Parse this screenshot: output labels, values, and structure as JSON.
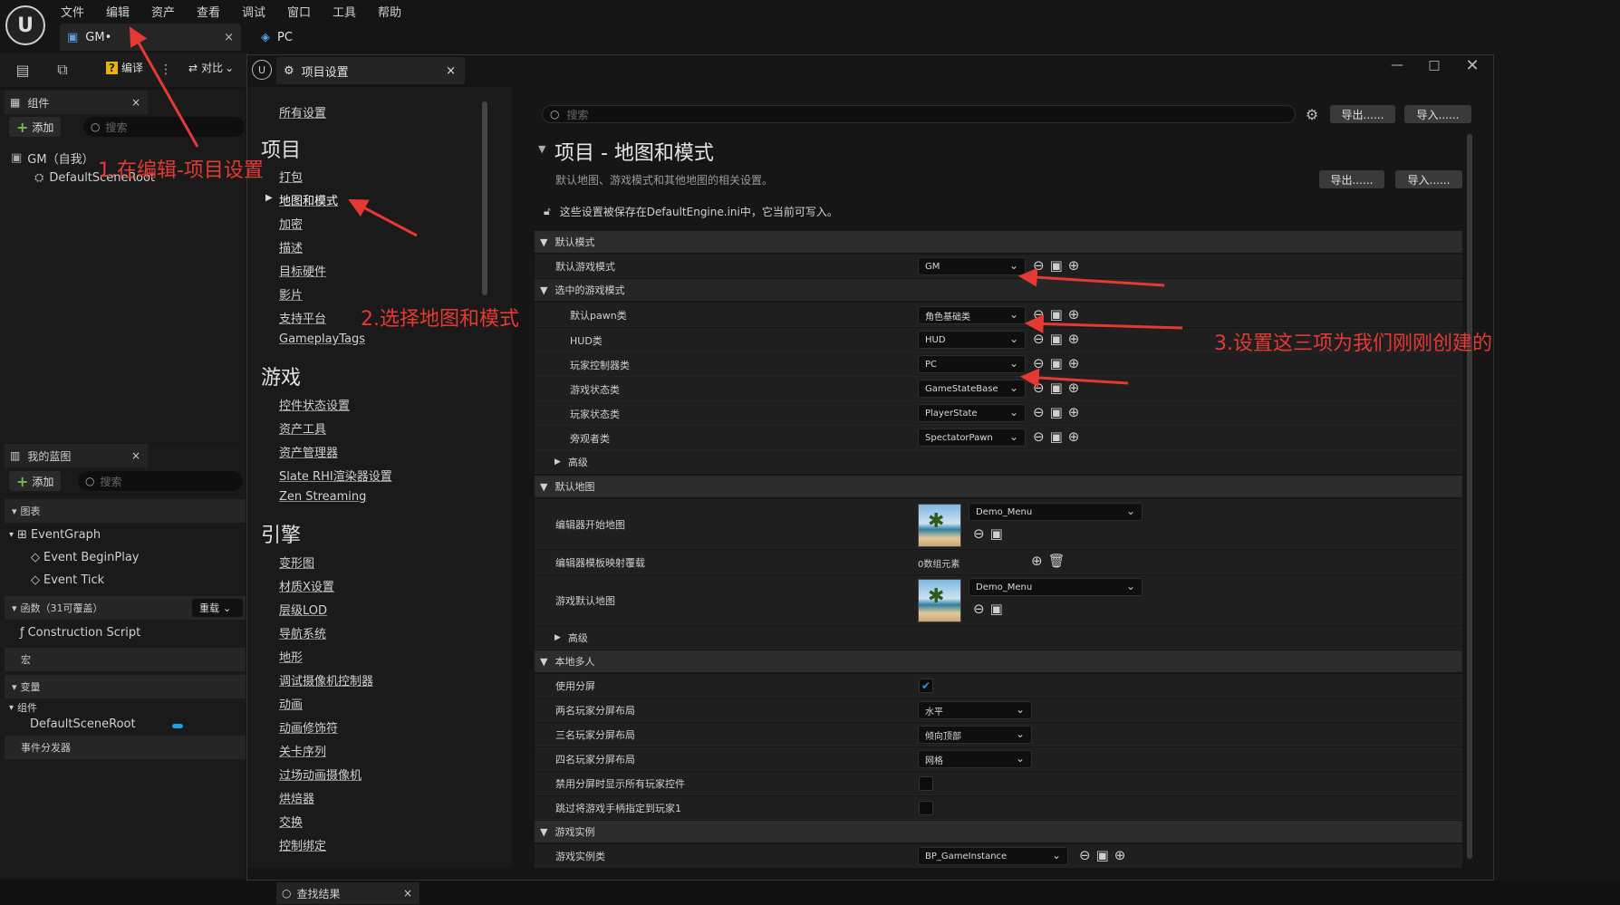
{
  "menu": [
    "文件",
    "编辑",
    "资产",
    "查看",
    "调试",
    "窗口",
    "工具",
    "帮助"
  ],
  "tabs": [
    {
      "label": "GM•"
    },
    {
      "label": "PC"
    }
  ],
  "toolbar": {
    "compile_label": "编译",
    "diff_label": "对比"
  },
  "components_panel": {
    "title": "组件",
    "add_label": "添加",
    "search_placeholder": "搜索",
    "items": [
      "GM（自我）",
      "DefaultSceneRoot"
    ]
  },
  "blueprint_panel": {
    "title": "我的蓝图",
    "add_label": "添加",
    "search_placeholder": "搜索",
    "graph_header": "图表",
    "event_graph": "EventGraph",
    "events": [
      "Event BeginPlay",
      "Event Tick"
    ],
    "functions_header": "函数（31可覆盖）",
    "override_label": "重载",
    "construction_script": "Construction Script",
    "macros_header": "宏",
    "variables_header": "变量",
    "components_group": "组件",
    "default_scene_root": "DefaultSceneRoot",
    "dispatchers_header": "事件分发器"
  },
  "settings_window": {
    "tab_title": "项目设置",
    "search_placeholder": "搜索",
    "export_label": "导出......",
    "import_label": "导入......",
    "nav": {
      "all_settings": "所有设置",
      "section_project": "项目",
      "project_items": [
        "打包",
        "地图和模式",
        "加密",
        "描述",
        "目标硬件",
        "影片",
        "支持平台",
        "GameplayTags"
      ],
      "section_game": "游戏",
      "game_items": [
        "控件状态设置",
        "资产工具",
        "资产管理器",
        "Slate RHI渲染器设置",
        "Zen Streaming"
      ],
      "section_engine": "引擎",
      "engine_items": [
        "变形图",
        "材质X设置",
        "层级LOD",
        "导航系统",
        "地形",
        "调试摄像机控制器",
        "动画",
        "动画修饰符",
        "关卡序列",
        "过场动画摄像机",
        "烘焙器",
        "交换",
        "控制绑定"
      ]
    },
    "page_title": "项目 - 地图和模式",
    "page_desc": "默认地图、游戏模式和其他地图的相关设置。",
    "ini_notice": "这些设置被保存在DefaultEngine.ini中，它当前可写入。",
    "sections": {
      "default_modes": "默认模式",
      "default_game_mode_label": "默认游戏模式",
      "default_game_mode_value": "GM",
      "selected_game_mode": "选中的游戏模式",
      "pawn_label": "默认pawn类",
      "pawn_value": "角色基础类",
      "hud_label": "HUD类",
      "hud_value": "HUD",
      "pc_label": "玩家控制器类",
      "pc_value": "PC",
      "gamestate_label": "游戏状态类",
      "gamestate_value": "GameStateBase",
      "playerstate_label": "玩家状态类",
      "playerstate_value": "PlayerState",
      "spectator_label": "旁观者类",
      "spectator_value": "SpectatorPawn",
      "advanced": "高级",
      "default_maps": "默认地图",
      "editor_startup_label": "编辑器开始地图",
      "editor_startup_value": "Demo_Menu",
      "template_override_label": "编辑器模板映射覆载",
      "template_override_value": "0数组元素",
      "game_default_label": "游戏默认地图",
      "game_default_value": "Demo_Menu",
      "local_multiplayer": "本地多人",
      "split_screen_label": "使用分屏",
      "two_player_label": "两名玩家分屏布局",
      "two_player_value": "水平",
      "three_player_label": "三名玩家分屏布局",
      "three_player_value": "倾向顶部",
      "four_player_label": "四名玩家分屏布局",
      "four_player_value": "网格",
      "show_all_controllers_label": "禁用分屏时显示所有玩家控件",
      "skip_gamepad_label": "跳过将游戏手柄指定到玩家1",
      "game_instance": "游戏实例",
      "game_instance_label": "游戏实例类",
      "game_instance_value": "BP_GameInstance"
    }
  },
  "find_results": {
    "title": "查找结果"
  },
  "annotations": {
    "step1": "1.在编辑-项目设置",
    "step2": "2.选择地图和模式",
    "step3": "3.设置这三项为我们刚刚创建的"
  }
}
